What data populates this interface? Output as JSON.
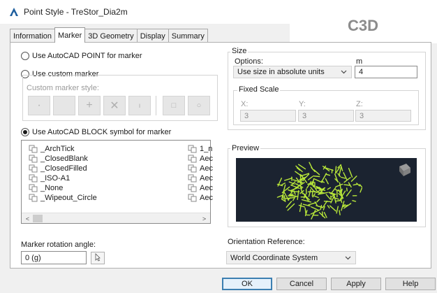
{
  "window": {
    "title": "Point Style - TreStor_Dia2m",
    "badge": "C3D"
  },
  "tabs": [
    {
      "label": "Information",
      "active": false
    },
    {
      "label": "Marker",
      "active": true
    },
    {
      "label": "3D Geometry",
      "active": false
    },
    {
      "label": "Display",
      "active": false
    },
    {
      "label": "Summary",
      "active": false
    }
  ],
  "marker": {
    "use_point_label": "Use AutoCAD POINT for marker",
    "use_custom_label": "Use custom marker",
    "custom_style_label": "Custom marker style:",
    "custom_buttons": [
      "dot",
      "blank",
      "plus",
      "x",
      "tick",
      "square",
      "circle"
    ],
    "use_block_label": "Use AutoCAD BLOCK symbol for marker",
    "selected_option": "block",
    "block_list_left": [
      "_ArchTick",
      "_ClosedBlank",
      "_ClosedFilled",
      "_ISO-A1",
      "_None",
      "_Wipeout_Circle"
    ],
    "block_list_right": [
      "1_n",
      "Aec",
      "Aec",
      "Aec",
      "Aec",
      "Aec"
    ],
    "rotation_label": "Marker rotation angle:",
    "rotation_value": "0 (g)"
  },
  "size": {
    "group_label": "Size",
    "options_label": "Options:",
    "options_value": "Use size in absolute units",
    "unit_label": "m",
    "unit_value": "4",
    "fixed_scale_label": "Fixed Scale",
    "x_label": "X:",
    "x_value": "3",
    "y_label": "Y:",
    "y_value": "3",
    "z_label": "Z:",
    "z_value": "3"
  },
  "preview": {
    "label": "Preview",
    "background": "#1b2330",
    "marker_color": "#b9e83a"
  },
  "orientation": {
    "label": "Orientation Reference:",
    "value": "World Coordinate System"
  },
  "buttons": {
    "ok": "OK",
    "cancel": "Cancel",
    "apply": "Apply",
    "help": "Help"
  },
  "colors": {
    "accent": "#3c7fb1",
    "dialog_bg": "#f0f0f0"
  }
}
